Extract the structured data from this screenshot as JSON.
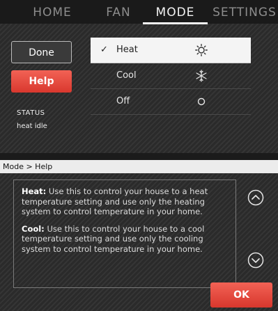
{
  "tabs": [
    {
      "label": "HOME",
      "active": false
    },
    {
      "label": "FAN",
      "active": false
    },
    {
      "label": "MODE",
      "active": true
    },
    {
      "label": "SETTINGS",
      "active": false
    }
  ],
  "sidebar": {
    "done_label": "Done",
    "help_label": "Help",
    "status_label": "STATUS",
    "status_value": "heat idle"
  },
  "mode_options": [
    {
      "check": "✓",
      "label": "Heat",
      "icon": "sun-icon",
      "selected": true
    },
    {
      "check": "",
      "label": "Cool",
      "icon": "snowflake-icon",
      "selected": false
    },
    {
      "check": "",
      "label": "Off",
      "icon": "off-circle-icon",
      "selected": false
    }
  ],
  "help": {
    "breadcrumb": "Mode > Help",
    "heat_title": "Heat:",
    "heat_text": " Use this to control your house to a heat temperature setting and use only the heating system to control temperature in your home.",
    "cool_title": "Cool:",
    "cool_text": " Use this to control your house to a cool temperature setting and use only the cooling system to control temperature in your home.",
    "ok_label": "OK"
  },
  "colors": {
    "accent": "#e84a3f",
    "panel": "#2a2a2a",
    "selected_row": "#f4f4f4"
  }
}
